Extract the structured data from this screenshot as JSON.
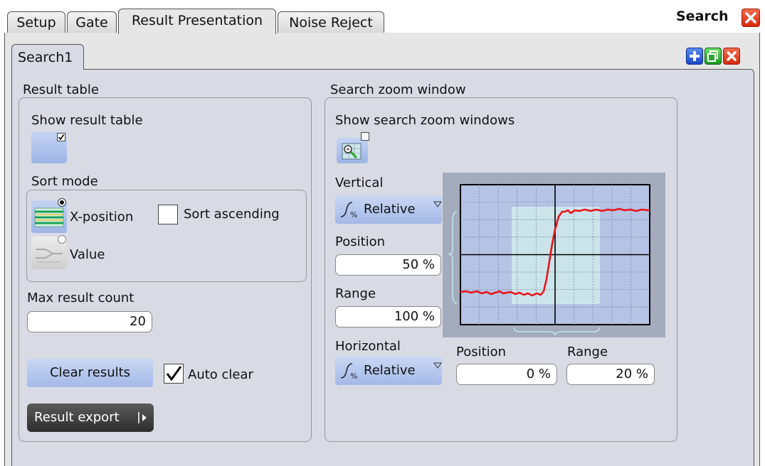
{
  "dialog": {
    "title": "Search"
  },
  "tabs": [
    {
      "label": "Setup"
    },
    {
      "label": "Gate"
    },
    {
      "label": "Result Presentation"
    },
    {
      "label": "Noise Reject"
    }
  ],
  "active_tab": "Result Presentation",
  "subtabs": [
    {
      "label": "Search1"
    }
  ],
  "result_table": {
    "group_title": "Result table",
    "show_label": "Show result table",
    "show_checked": true,
    "sort_mode_label": "Sort mode",
    "sort_options": [
      {
        "label": "X-position",
        "selected": true
      },
      {
        "label": "Value",
        "selected": false
      }
    ],
    "sort_ascending_label": "Sort ascending",
    "sort_ascending_checked": false,
    "max_count_label": "Max result count",
    "max_count_value": "20",
    "clear_label": "Clear results",
    "auto_clear_label": "Auto clear",
    "auto_clear_checked": true,
    "export_label": "Result export"
  },
  "zoom_window": {
    "group_title": "Search zoom window",
    "show_label": "Show search zoom windows",
    "show_checked": false,
    "vertical_label": "Vertical",
    "vertical_mode": "Relative",
    "position_label": "Position",
    "position_value": "50 %",
    "range_label": "Range",
    "range_value": "100 %",
    "horizontal_label": "Horizontal",
    "horizontal_mode": "Relative",
    "h_position_label": "Position",
    "h_position_value": "0 %",
    "h_range_label": "Range",
    "h_range_value": "20 %"
  },
  "colors": {
    "panel": "#d8dbe4",
    "button_blue": "#a4b9e8",
    "trace": "#e8141c",
    "zoom_highlight": "#bfe6e6",
    "close_red": "#d62a10"
  },
  "icons": {
    "close": "close-x-icon",
    "add": "plus-icon",
    "copy": "copy-icon",
    "delete": "delete-x-icon",
    "dropdown": "dropdown-triangle-icon",
    "relative": "relative-scale-icon",
    "zoom": "zoom-window-icon",
    "export_arrow": "right-arrow-icon"
  }
}
